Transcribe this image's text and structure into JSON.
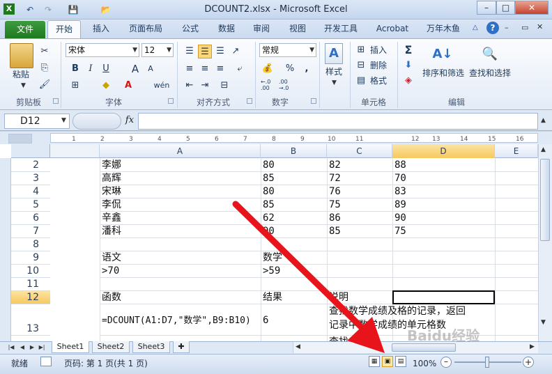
{
  "window": {
    "title": "DCOUNT2.xlsx - Microsoft Excel",
    "app_icon": "X",
    "minimize": "–",
    "maximize": "□",
    "close": "✕"
  },
  "quick_access": {
    "save": "💾",
    "undo": "↶",
    "redo": "↷",
    "open": "📂"
  },
  "ribbon_tabs": [
    "文件",
    "开始",
    "插入",
    "页面布局",
    "公式",
    "数据",
    "审阅",
    "视图",
    "开发工具",
    "Acrobat",
    "万年木鱼"
  ],
  "ribbon": {
    "clipboard": {
      "label": "剪贴板",
      "paste": "粘贴"
    },
    "font": {
      "label": "字体",
      "name": "宋体",
      "size": "12",
      "bold": "B",
      "italic": "I",
      "underline": "U",
      "grow": "A",
      "shrink": "A",
      "phonetic": "wén"
    },
    "alignment": {
      "label": "对齐方式"
    },
    "number": {
      "label": "数字",
      "format": "常规",
      "percent": "%",
      "comma": ",",
      "inc": "←.0 .00",
      "dec": ".00 →.0"
    },
    "styles": {
      "label": "样式"
    },
    "cells": {
      "label": "单元格",
      "insert": "插入",
      "delete": "删除",
      "format": "格式"
    },
    "editing": {
      "label": "编辑",
      "sum": "Σ",
      "sort": "排序和筛选",
      "find": "查找和选择"
    }
  },
  "formula_bar": {
    "name_box": "D12",
    "fx": "fx",
    "formula": ""
  },
  "ruler_ticks": [
    "1",
    "2",
    "3",
    "4",
    "5",
    "6",
    "7",
    "8",
    "9",
    "10",
    "11",
    "12",
    "13",
    "14",
    "15",
    "16"
  ],
  "columns": [
    "A",
    "B",
    "C",
    "D",
    "E"
  ],
  "rows": [
    "2",
    "3",
    "4",
    "5",
    "6",
    "7",
    "8",
    "9",
    "10",
    "11",
    "12",
    "13"
  ],
  "cells": {
    "r2": [
      "李娜",
      "80",
      "82",
      "88"
    ],
    "r3": [
      "高辉",
      "85",
      "72",
      "70"
    ],
    "r4": [
      "宋琳",
      "80",
      "76",
      "83"
    ],
    "r5": [
      "李侃",
      "85",
      "75",
      "89"
    ],
    "r6": [
      "辛鑫",
      "62",
      "86",
      "90"
    ],
    "r7": [
      "潘科",
      "90",
      "85",
      "75"
    ],
    "r9": [
      "语文",
      "数学"
    ],
    "r10": [
      ">70",
      ">59"
    ],
    "r12": [
      "函数",
      "结果",
      "说明"
    ],
    "r13": [
      "=DCOUNT(A1:D7,\"数学\",B9:B10)",
      "6",
      "查找数学成绩及格的记录，返回",
      "记录中数学成绩的单元格数"
    ],
    "r14_partial": "查找..."
  },
  "sheet_tabs": [
    "Sheet1",
    "Sheet2",
    "Sheet3"
  ],
  "status_bar": {
    "ready": "就绪",
    "page": "页码: 第 1 页(共 1 页)",
    "zoom": "100%"
  },
  "watermark": "Baidu经验"
}
